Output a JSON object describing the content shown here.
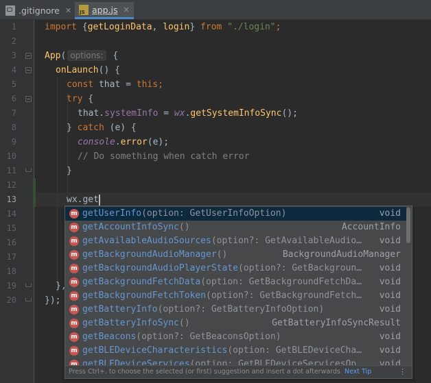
{
  "tabs": [
    {
      "label": ".gitignore",
      "icon": "git-file-icon",
      "active": false
    },
    {
      "label": "app.js",
      "icon": "js-file-icon",
      "active": true
    }
  ],
  "editor": {
    "line_numbers": [
      "1",
      "2",
      "3",
      "4",
      "5",
      "6",
      "7",
      "8",
      "9",
      "10",
      "11",
      "12",
      "13",
      "14",
      "15",
      "16",
      "17",
      "18",
      "19",
      "20"
    ],
    "current_line": "13",
    "param_hint": "options:",
    "code_lines": {
      "l1": {
        "kw1": "import",
        "p1": " {",
        "fn1": "getLoginData",
        "p2": ", ",
        "fn2": "login",
        "p3": "} ",
        "kw2": "from",
        "p4": " ",
        "str": "\"./login\"",
        "p5": ";"
      },
      "l3": {
        "fn": "App",
        "p1": "(",
        "p2": " {"
      },
      "l4": {
        "fn": "onLaunch",
        "p1": "() {"
      },
      "l5": {
        "kw1": "const",
        "p1": " that = ",
        "kw2": "this",
        "p2": ";"
      },
      "l6": {
        "kw": "try",
        "p1": " {"
      },
      "l7": {
        "p1": "that.",
        "prop": "systemInfo",
        "p2": " = ",
        "glob": "wx",
        "p3": ".",
        "fn": "getSystemInfoSync",
        "p4": "();"
      },
      "l8": {
        "p1": "} ",
        "kw": "catch",
        "p2": " (e) {"
      },
      "l9": {
        "glob": "console",
        "p1": ".",
        "fn": "error",
        "p2": "(e);"
      },
      "l10": {
        "cmt": "// Do something when catch error"
      },
      "l11": {
        "p1": "}"
      },
      "l13": {
        "p1": "wx.get"
      },
      "l19": {
        "p1": "},"
      },
      "l20": {
        "p1": "});"
      }
    }
  },
  "completion": {
    "items": [
      {
        "badge": "m",
        "name": "getUserInfo",
        "params": "(option: GetUserInfoOption)",
        "type": "void",
        "selected": true
      },
      {
        "badge": "m",
        "name": "getAccountInfoSync",
        "params": "()",
        "type": "AccountInfo",
        "selected": false
      },
      {
        "badge": "m",
        "name": "getAvailableAudioSources",
        "params": "(option?: GetAvailableAudio…",
        "type": "void",
        "selected": false
      },
      {
        "badge": "m",
        "name": "getBackgroundAudioManager",
        "params": "()",
        "type": "BackgroundAudioManager",
        "selected": false
      },
      {
        "badge": "m",
        "name": "getBackgroundAudioPlayerState",
        "params": "(option?: GetBackgroun…",
        "type": "void",
        "selected": false
      },
      {
        "badge": "m",
        "name": "getBackgroundFetchData",
        "params": "(option: GetBackgroundFetchDa…",
        "type": "void",
        "selected": false
      },
      {
        "badge": "m",
        "name": "getBackgroundFetchToken",
        "params": "(option?: GetBackgroundFetch…",
        "type": "void",
        "selected": false
      },
      {
        "badge": "m",
        "name": "getBatteryInfo",
        "params": "(option?: GetBatteryInfoOption)",
        "type": "void",
        "selected": false
      },
      {
        "badge": "m",
        "name": "getBatteryInfoSync",
        "params": "()",
        "type": "GetBatteryInfoSyncResult",
        "selected": false
      },
      {
        "badge": "m",
        "name": "getBeacons",
        "params": "(option?: GetBeaconsOption)",
        "type": "void",
        "selected": false
      },
      {
        "badge": "m",
        "name": "getBLEDeviceCharacteristics",
        "params": "(option: GetBLEDeviceCha…",
        "type": "void",
        "selected": false
      },
      {
        "badge": "m",
        "name": "getBLEDeviceServices",
        "params": "(option: GetBLEDeviceServicesOp…",
        "type": "void",
        "selected": false
      }
    ],
    "footer_text": "Press Ctrl+. to choose the selected (or first) suggestion and insert a dot afterwards",
    "next_tip": "Next Tip",
    "more_icon": "⋮"
  },
  "colors": {
    "keyword": "#cc7832",
    "string": "#6a8759",
    "function": "#ffc66d",
    "property": "#9876aa",
    "comment": "#808080",
    "selection": "#0d293e",
    "link": "#589df6"
  }
}
